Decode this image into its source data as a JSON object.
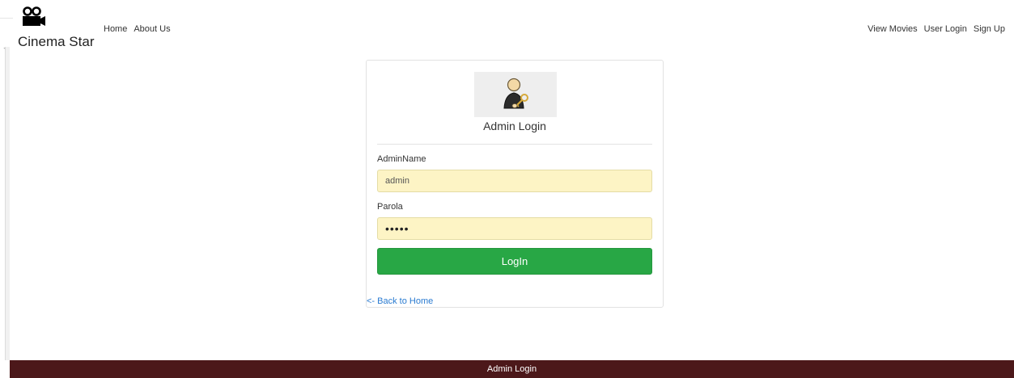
{
  "brand": {
    "name": "Cinema Star",
    "logo_icon": "movie-camera-icon"
  },
  "nav": {
    "left": [
      {
        "label": "Home"
      },
      {
        "label": "About Us"
      }
    ],
    "right": [
      {
        "label": "View Movies"
      },
      {
        "label": "User Login"
      },
      {
        "label": "Sign Up"
      }
    ]
  },
  "login_card": {
    "avatar_icon": "admin-user-key-icon",
    "title": "Admin Login",
    "username_label": "AdminName",
    "username_value": "admin",
    "password_label": "Parola",
    "password_value": "•••••",
    "submit_label": "LogIn",
    "back_link": "<- Back to Home"
  },
  "footer": {
    "text": "Admin Login"
  },
  "colors": {
    "submit_button": "#28a745",
    "input_autofill": "#fdf4c5",
    "footer_bg": "#4c181a",
    "link": "#2a7bd1"
  }
}
